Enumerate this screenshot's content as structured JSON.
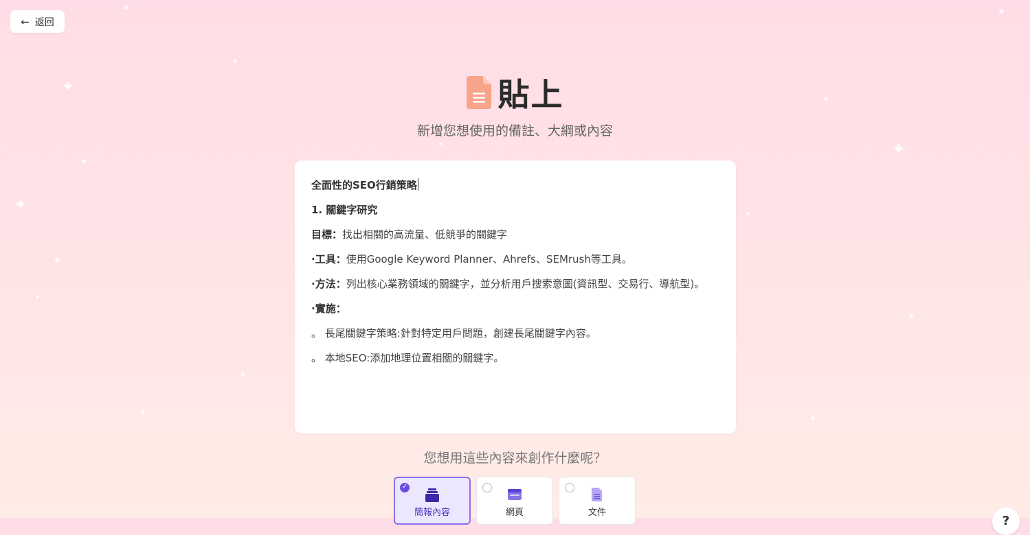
{
  "back_button": {
    "label": "返回",
    "icon": "arrow-left-icon"
  },
  "header": {
    "title": "貼上",
    "subtitle": "新增您想使用的備註、大綱或內容",
    "icon": "document-icon",
    "icon_color": "#f7a48b"
  },
  "editor": {
    "heading": "全面性的SEO行銷策略",
    "section_title": "1. 關鍵字研究",
    "goal_label": "目標：",
    "goal_text": "找出相關的高流量、低競爭的關鍵字",
    "tools_label": "·工具：",
    "tools_text": "使用Google Keyword Planner、Ahrefs、SEMrush等工具。",
    "method_label": "·方法：",
    "method_text": "列出核心業務領域的關鍵字，並分析用戶搜索意圖(資訊型、交易行、導航型)。",
    "implement_label": "·實施：",
    "bullet_1": "。 長尾關鍵字策略:針對特定用戶問題，創建長尾關鍵字內容。",
    "bullet_2": "。 本地SEO:添加地理位置相關的關鍵字。"
  },
  "question": "您想用這些內容來創作什麼呢？",
  "options": [
    {
      "label": "簡報內容",
      "icon": "presentation-icon",
      "selected": true
    },
    {
      "label": "網頁",
      "icon": "webpage-icon",
      "selected": false
    },
    {
      "label": "文件",
      "icon": "document-icon",
      "selected": false
    }
  ],
  "help_button": {
    "label": "?"
  },
  "colors": {
    "accent": "#6a4ce0",
    "selected_bg": "#ece7ff",
    "background": "#ffe3e6"
  }
}
